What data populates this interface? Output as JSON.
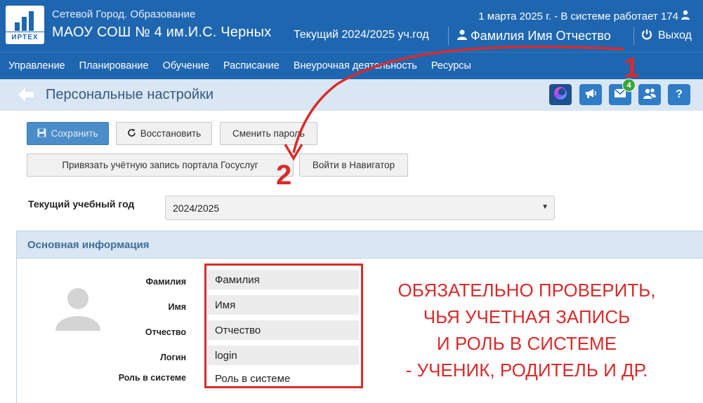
{
  "header": {
    "app_name": "Сетевой Город. Образование",
    "logo_text": "ИРТЕХ",
    "school_name": "МАОУ СОШ № 4 им.И.С. Черных",
    "year": "Текущий 2024/2025 уч.год",
    "date_status": "1 марта 2025 г. - В системе работает 174",
    "user_name": "Фамилия Имя Отчество",
    "logout": "Выход"
  },
  "nav": {
    "items": [
      "Управление",
      "Планирование",
      "Обучение",
      "Расписание",
      "Внеурочная деятельность",
      "Ресурсы"
    ]
  },
  "titlebar": {
    "title": "Персональные настройки",
    "mail_badge": "4",
    "help": "?"
  },
  "toolbar": {
    "save": "Сохранить",
    "restore": "Восстановить",
    "change_password": "Сменить пароль",
    "link_gosuslugi": "Привязать учётную запись портала Госуслуг",
    "navigator": "Войти в Навигатор"
  },
  "current_year": {
    "label": "Текущий учебный год",
    "value": "2024/2025"
  },
  "panel": {
    "title": "Основная информация",
    "fields": [
      {
        "label": "Фамилия",
        "value": "Фамилия"
      },
      {
        "label": "Имя",
        "value": "Имя"
      },
      {
        "label": "Отчество",
        "value": "Отчество"
      },
      {
        "label": "Логин",
        "value": "login"
      },
      {
        "label": "Роль в системе",
        "value": "Роль в системе"
      }
    ]
  },
  "annotation": {
    "lines": [
      "ОБЯЗАТЕЛЬНО ПРОВЕРИТЬ,",
      "ЧЬЯ УЧЕТНАЯ ЗАПИСЬ",
      "И РОЛЬ В СИСТЕМЕ",
      "- УЧЕНИК, РОДИТЕЛЬ И ДР."
    ],
    "marker1": "1",
    "marker2": "2"
  },
  "colors": {
    "header_bg": "#1f66b1",
    "titlebar_bg": "#d9e6f3",
    "annotation_red": "#d92b2b",
    "badge_green": "#3aa63a"
  }
}
